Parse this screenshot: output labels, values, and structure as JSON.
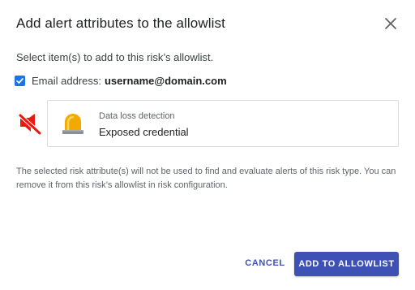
{
  "dialog": {
    "title": "Add alert attributes to the allowlist",
    "close_icon": "close-icon",
    "subtitle": "Select item(s) to add to this risk’s allowlist."
  },
  "attribute": {
    "checked": true,
    "label": "Email address:",
    "value": "username@domain.com"
  },
  "risk": {
    "status_icon": "muted-notification-icon",
    "icon": "siren-icon",
    "category": "Data loss detection",
    "name": "Exposed credential"
  },
  "note": "The selected risk attribute(s) will not be used to find and evaluate alerts of this risk type. You can remove it from this risk’s allowlist in risk configuration.",
  "actions": {
    "cancel_label": "CANCEL",
    "add_label": "ADD TO ALLOWLIST"
  },
  "colors": {
    "accent": "#3f51b5",
    "checkbox": "#1a73e8",
    "mute_red": "#e8190f",
    "siren_amber": "#f2a900"
  }
}
